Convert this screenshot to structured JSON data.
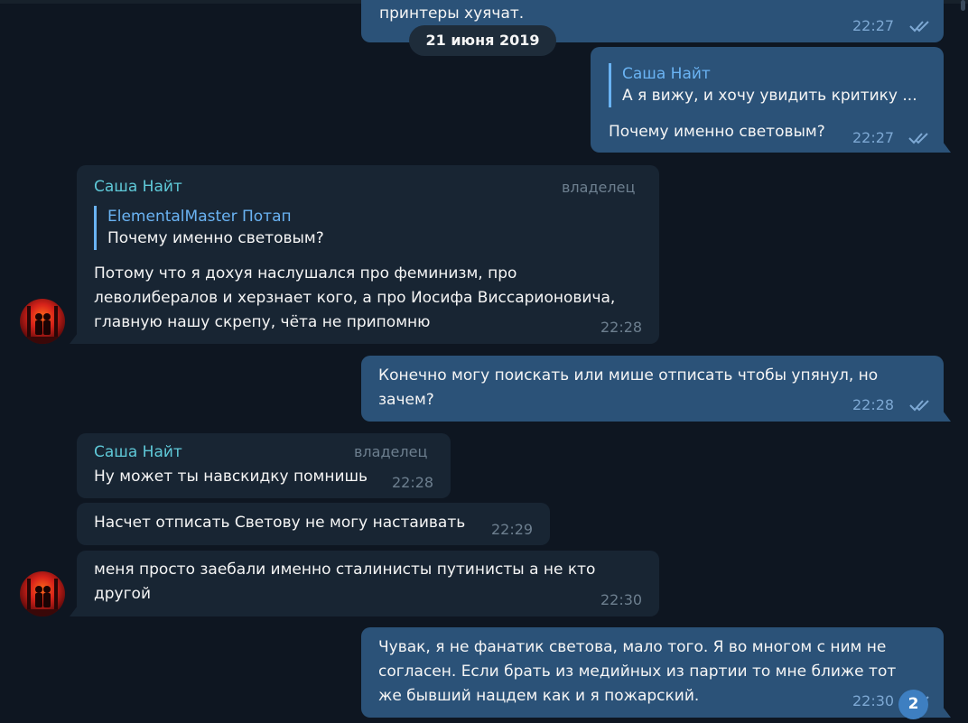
{
  "date_separator": "21 июня 2019",
  "unread_badge": "2",
  "messages": [
    {
      "direction": "out",
      "text": "принтеры хуячат.",
      "time": "22:27",
      "read": true
    },
    {
      "direction": "out",
      "reply": {
        "name": "Саша Найт",
        "text": "А я вижу, и хочу увидить критику ..."
      },
      "text": "Почему именно световым?",
      "time": "22:27",
      "read": true
    },
    {
      "direction": "in",
      "sender": "Саша Найт",
      "role": "владелец",
      "reply": {
        "name": "ElementalMaster Потап",
        "text": "Почему именно световым?"
      },
      "text": "Потому что я дохуя наслушался про феминизм, про\nлеволибералов и херзнает кого, а про Иосифа Виссарионовича,\nглавную нашу скрепу, чёта не припомню",
      "time": "22:28"
    },
    {
      "direction": "out",
      "text": "Конечно могу поискать или мише отписать чтобы упянул, но\nзачем?",
      "time": "22:28",
      "read": true
    },
    {
      "direction": "in",
      "sender": "Саша Найт",
      "role": "владелец",
      "text": "Ну может ты навскидку помнишь",
      "time": "22:28"
    },
    {
      "direction": "in",
      "text": "Насчет отписать Светову не могу настаивать",
      "time": "22:29"
    },
    {
      "direction": "in",
      "text": "меня просто заебали именно сталинисты путинисты а не кто\nдругой",
      "time": "22:30"
    },
    {
      "direction": "out",
      "text": "Чувак, я не фанатик светова, мало того. Я во многом с ним не\nсогласен. Если брать из медийных из партии то мне ближе тот\nже бывший нацдем как и я пожарский.",
      "time": "22:30",
      "read": true
    }
  ],
  "icons": {
    "read_check": "double-check-icon",
    "avatar": "user-avatar"
  },
  "colors": {
    "background": "#0e1621",
    "incoming_bubble": "#182533",
    "outgoing_bubble": "#2b5278",
    "sender_name": "#5fc9d8",
    "reply_accent": "#6ab3f3",
    "badge": "#3e7fc1"
  }
}
